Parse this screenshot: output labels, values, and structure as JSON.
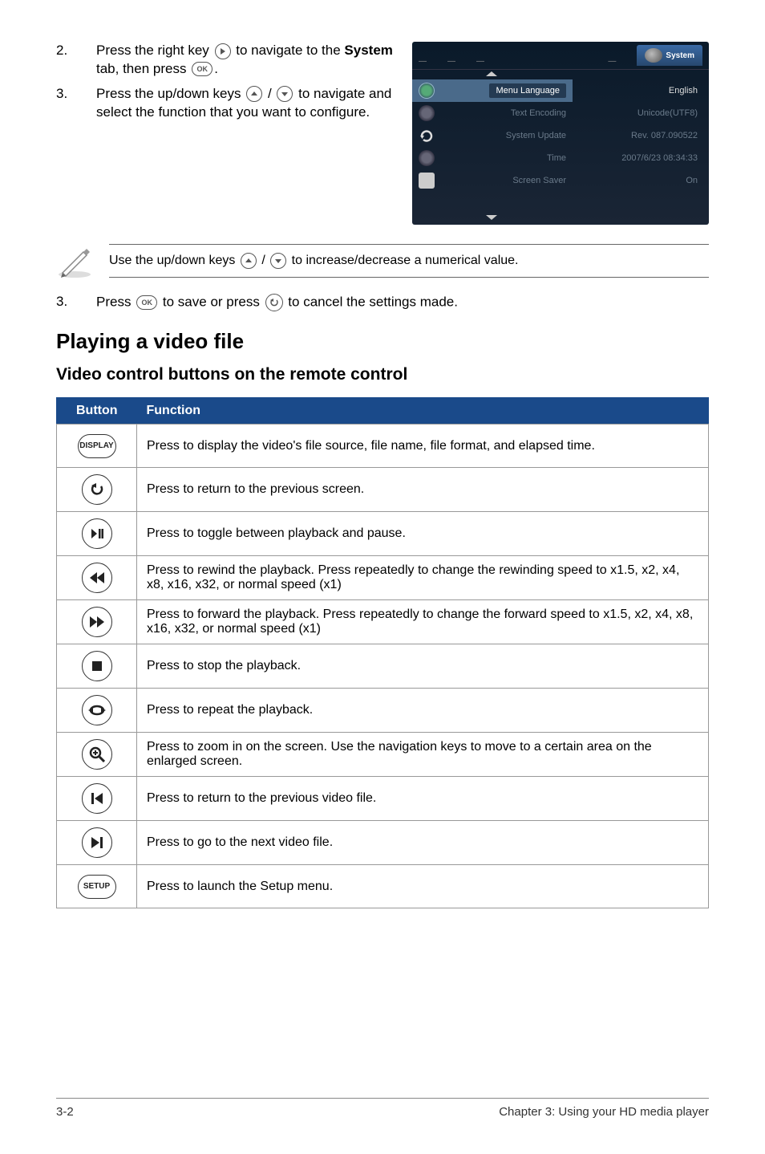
{
  "steps": {
    "s2_a": "Press the right key ",
    "s2_b": " to navigate to the ",
    "s2_bold": "System",
    "s2_c": " tab, then press ",
    "s2_ok": "OK",
    "s3_a": "Press the up/down keys ",
    "s3_b": " / ",
    "s3_c": " to navigate and select the function that you want to configure."
  },
  "screenshot": {
    "tab_active": "System",
    "rows": [
      {
        "label": "Menu Language",
        "value": "English"
      },
      {
        "label": "Text Encoding",
        "value": "Unicode(UTF8)"
      },
      {
        "label": "System Update",
        "value": "Rev. 087.090522"
      },
      {
        "label": "Time",
        "value": "2007/6/23 08:34:33"
      },
      {
        "label": "Screen Saver",
        "value": "On"
      }
    ]
  },
  "note": {
    "a": "Use the up/down keys ",
    "b": " / ",
    "c": " to increase/decrease a numerical value."
  },
  "step3b": {
    "a": "Press ",
    "ok": "OK",
    "b": " to save or press ",
    "c": " to cancel the settings made."
  },
  "h2": "Playing a video file",
  "h3": "Video control buttons on the remote control",
  "table": {
    "h1": "Button",
    "h2": "Function",
    "rows": [
      {
        "btn": "DISPLAY",
        "fn": "Press to display the video's file source, file name, file format, and elapsed time."
      },
      {
        "btn": "back",
        "fn": "Press to return to the previous screen."
      },
      {
        "btn": "playpause",
        "fn": "Press to toggle between playback and pause."
      },
      {
        "btn": "rewind",
        "fn": "Press to rewind the playback. Press repeatedly to change the rewinding speed to x1.5, x2, x4, x8, x16, x32, or normal speed (x1)"
      },
      {
        "btn": "forward",
        "fn": "Press to forward the playback. Press repeatedly to change the forward speed to x1.5, x2, x4, x8, x16, x32, or normal speed (x1)"
      },
      {
        "btn": "stop",
        "fn": "Press to stop the playback."
      },
      {
        "btn": "repeat",
        "fn": "Press to repeat the playback."
      },
      {
        "btn": "zoom",
        "fn": "Press to zoom in on the screen. Use the navigation keys to move to a certain area on the enlarged screen."
      },
      {
        "btn": "prev",
        "fn": "Press to return to the previous video file."
      },
      {
        "btn": "next",
        "fn": "Press to go to the next video file."
      },
      {
        "btn": "SETUP",
        "fn": "Press to launch the Setup menu."
      }
    ]
  },
  "footer": {
    "left": "3-2",
    "right": "Chapter 3: Using your HD media player"
  }
}
